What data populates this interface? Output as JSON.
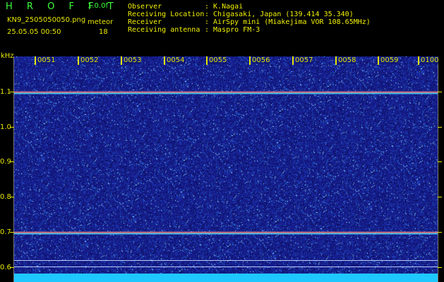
{
  "header": {
    "title": "H R O F F T",
    "version": "1.0.0f",
    "filename": "KN9_2505050050.png",
    "datetime": "25.05.05 00:50",
    "meteor_label": "meteor",
    "meteor_count": "18",
    "info": [
      {
        "label": "Observer",
        "value": ": K.Nagai"
      },
      {
        "label": "Receiving Location",
        "value": ": Chigasaki, Japan (139.414 35.340)"
      },
      {
        "label": "Receiver",
        "value": ": AirSpy mini (Miakejima VOR 108.65MHz)"
      },
      {
        "label": "Receiving antenna",
        "value": ": Maspro FM-3"
      }
    ]
  },
  "axes": {
    "y_unit": "kHz",
    "y_ticks": [
      "1.1",
      "1.0",
      "0.9",
      "0.8",
      "0.7",
      "0.6"
    ],
    "x_ticks": [
      "0051",
      "0052",
      "0053",
      "0054",
      "0055",
      "0056",
      "0057",
      "0058",
      "0059",
      "0100"
    ]
  },
  "colors": {
    "background": "#000000",
    "plot_background": "#1a1e8c",
    "text_yellow": "#e6e600",
    "title_green": "#3cff3c",
    "floor_cyan": "#1ec8ff"
  }
}
